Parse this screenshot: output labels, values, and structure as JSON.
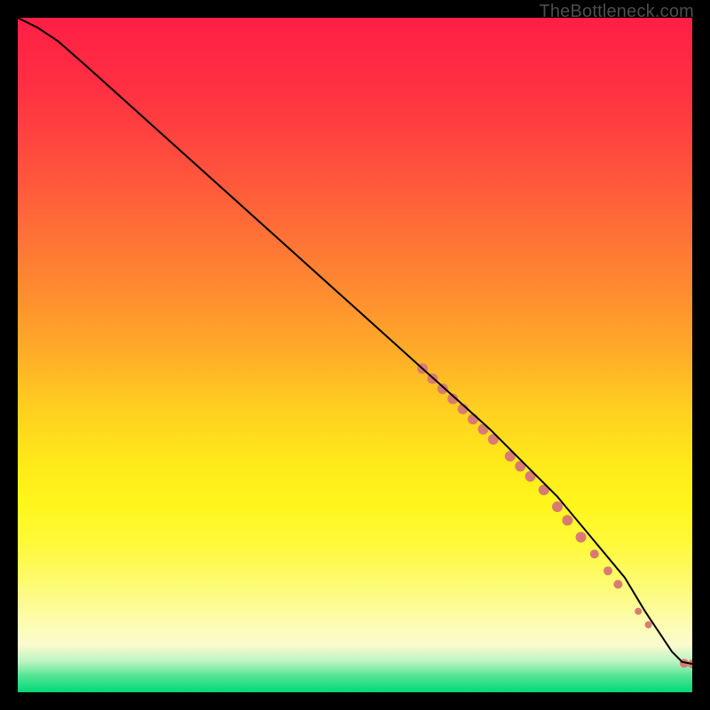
{
  "watermark": "TheBottleneck.com",
  "chart_data": {
    "type": "line",
    "title": "",
    "xlabel": "",
    "ylabel": "",
    "xlim": [
      0,
      100
    ],
    "ylim": [
      0,
      100
    ],
    "curve": {
      "name": "bottleneck-curve",
      "color": "#000000",
      "x": [
        0,
        3,
        6,
        10,
        20,
        30,
        40,
        50,
        60,
        70,
        80,
        90,
        93,
        95,
        97,
        98.5,
        100
      ],
      "y": [
        100,
        98.5,
        96.5,
        93,
        84,
        75,
        66,
        57,
        48,
        39,
        29,
        17,
        12,
        9,
        6,
        4.5,
        4.2
      ]
    },
    "highlight": {
      "name": "highlighted-points",
      "color": "#da7b72",
      "points": [
        {
          "x": 60,
          "y": 48,
          "r": 6
        },
        {
          "x": 61.5,
          "y": 46.5,
          "r": 6
        },
        {
          "x": 63,
          "y": 45,
          "r": 6
        },
        {
          "x": 64.5,
          "y": 43.5,
          "r": 6
        },
        {
          "x": 66,
          "y": 42,
          "r": 6
        },
        {
          "x": 67.5,
          "y": 40.5,
          "r": 6
        },
        {
          "x": 69,
          "y": 39,
          "r": 6
        },
        {
          "x": 70.5,
          "y": 37.5,
          "r": 6
        },
        {
          "x": 73,
          "y": 35,
          "r": 6
        },
        {
          "x": 74.5,
          "y": 33.5,
          "r": 6
        },
        {
          "x": 76,
          "y": 32,
          "r": 6
        },
        {
          "x": 78,
          "y": 30,
          "r": 6
        },
        {
          "x": 80,
          "y": 27.5,
          "r": 6
        },
        {
          "x": 81.5,
          "y": 25.5,
          "r": 6
        },
        {
          "x": 83.5,
          "y": 23,
          "r": 6
        },
        {
          "x": 85.5,
          "y": 20.5,
          "r": 5
        },
        {
          "x": 87.5,
          "y": 18,
          "r": 5
        },
        {
          "x": 89,
          "y": 16,
          "r": 5
        },
        {
          "x": 92,
          "y": 12,
          "r": 4
        },
        {
          "x": 93.5,
          "y": 10,
          "r": 4
        },
        {
          "x": 98.8,
          "y": 4.3,
          "r": 5
        },
        {
          "x": 100,
          "y": 4.2,
          "r": 5
        }
      ]
    },
    "gradient": {
      "stops": [
        {
          "offset": 0.0,
          "color": "#ff1f45"
        },
        {
          "offset": 0.1,
          "color": "#ff2f42"
        },
        {
          "offset": 0.2,
          "color": "#ff4a3e"
        },
        {
          "offset": 0.3,
          "color": "#ff6a38"
        },
        {
          "offset": 0.4,
          "color": "#ff8a30"
        },
        {
          "offset": 0.5,
          "color": "#ffad28"
        },
        {
          "offset": 0.58,
          "color": "#ffcf20"
        },
        {
          "offset": 0.66,
          "color": "#ffe91a"
        },
        {
          "offset": 0.72,
          "color": "#fff61c"
        },
        {
          "offset": 0.78,
          "color": "#fff93a"
        },
        {
          "offset": 0.84,
          "color": "#fdfb72"
        },
        {
          "offset": 0.89,
          "color": "#fcfca8"
        },
        {
          "offset": 0.93,
          "color": "#fbfbd0"
        },
        {
          "offset": 0.955,
          "color": "#b9f3c0"
        },
        {
          "offset": 0.975,
          "color": "#56e595"
        },
        {
          "offset": 1.0,
          "color": "#00d977"
        }
      ]
    }
  }
}
